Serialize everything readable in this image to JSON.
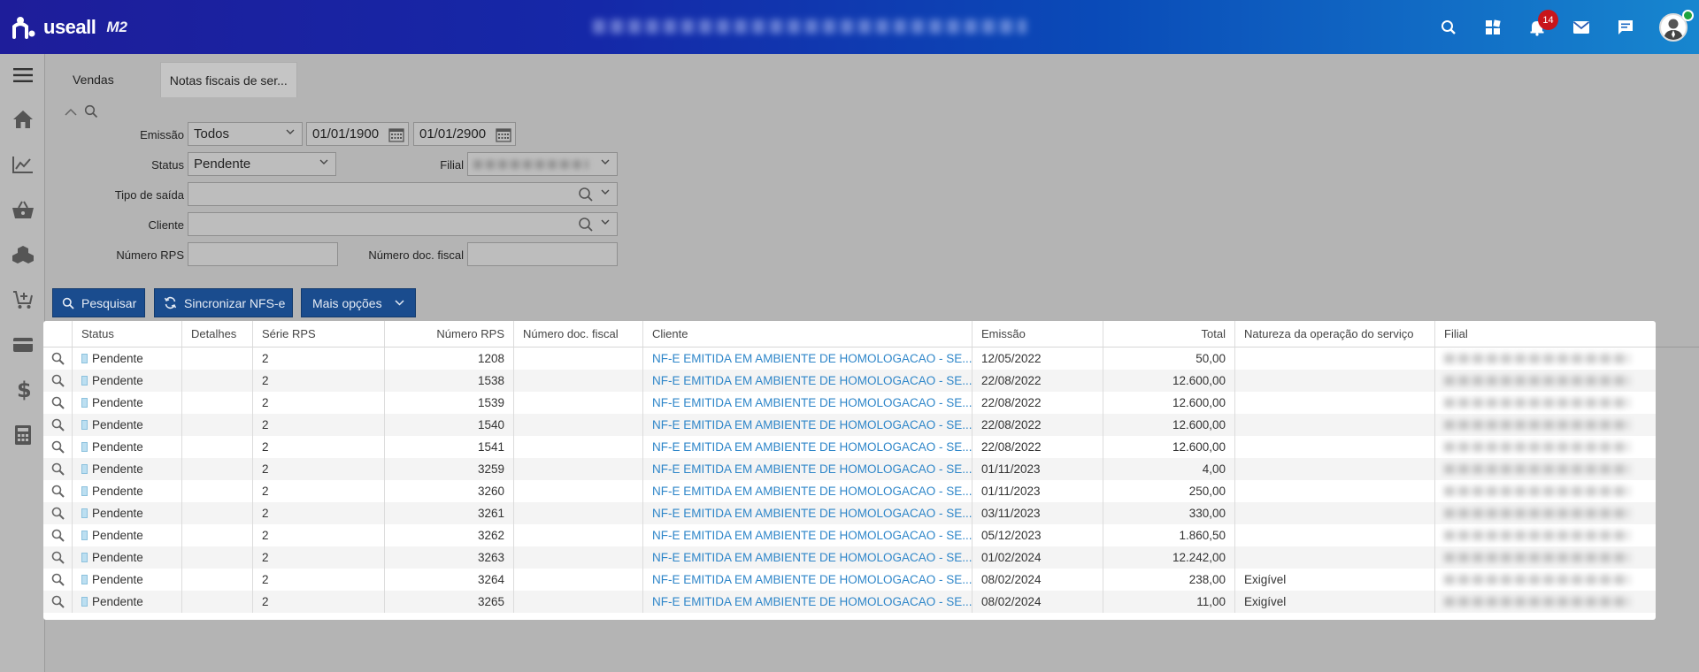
{
  "app": {
    "logo_text": "useall",
    "logo_sub": "M2",
    "notification_count": "14"
  },
  "tabs": [
    {
      "label": "Vendas"
    },
    {
      "label": "Notas fiscais de ser..."
    }
  ],
  "filters": {
    "emissao_label": "Emissão",
    "emissao_value": "Todos",
    "date_from": "01/01/1900",
    "date_to": "01/01/2900",
    "status_label": "Status",
    "status_value": "Pendente",
    "filial_label": "Filial",
    "tipo_saida_label": "Tipo de saída",
    "cliente_label": "Cliente",
    "numero_rps_label": "Número RPS",
    "numero_doc_label": "Número doc. fiscal"
  },
  "buttons": {
    "pesquisar": "Pesquisar",
    "sincronizar": "Sincronizar NFS-e",
    "mais_opcoes": "Mais opções"
  },
  "table": {
    "columns": [
      "",
      "Status",
      "Detalhes",
      "Série RPS",
      "Número RPS",
      "Número doc. fiscal",
      "Cliente",
      "Emissão",
      "Total",
      "Natureza da operação do serviço",
      "Filial"
    ],
    "rows": [
      {
        "status": "Pendente",
        "serie": "2",
        "numero": "1208",
        "cliente": "NF-E EMITIDA EM AMBIENTE DE HOMOLOGACAO - SE...",
        "emissao": "12/05/2022",
        "total": "50,00",
        "natureza": ""
      },
      {
        "status": "Pendente",
        "serie": "2",
        "numero": "1538",
        "cliente": "NF-E EMITIDA EM AMBIENTE DE HOMOLOGACAO - SE...",
        "emissao": "22/08/2022",
        "total": "12.600,00",
        "natureza": ""
      },
      {
        "status": "Pendente",
        "serie": "2",
        "numero": "1539",
        "cliente": "NF-E EMITIDA EM AMBIENTE DE HOMOLOGACAO - SE...",
        "emissao": "22/08/2022",
        "total": "12.600,00",
        "natureza": ""
      },
      {
        "status": "Pendente",
        "serie": "2",
        "numero": "1540",
        "cliente": "NF-E EMITIDA EM AMBIENTE DE HOMOLOGACAO - SE...",
        "emissao": "22/08/2022",
        "total": "12.600,00",
        "natureza": ""
      },
      {
        "status": "Pendente",
        "serie": "2",
        "numero": "1541",
        "cliente": "NF-E EMITIDA EM AMBIENTE DE HOMOLOGACAO - SE...",
        "emissao": "22/08/2022",
        "total": "12.600,00",
        "natureza": ""
      },
      {
        "status": "Pendente",
        "serie": "2",
        "numero": "3259",
        "cliente": "NF-E EMITIDA EM AMBIENTE DE HOMOLOGACAO - SE...",
        "emissao": "01/11/2023",
        "total": "4,00",
        "natureza": ""
      },
      {
        "status": "Pendente",
        "serie": "2",
        "numero": "3260",
        "cliente": "NF-E EMITIDA EM AMBIENTE DE HOMOLOGACAO - SE...",
        "emissao": "01/11/2023",
        "total": "250,00",
        "natureza": ""
      },
      {
        "status": "Pendente",
        "serie": "2",
        "numero": "3261",
        "cliente": "NF-E EMITIDA EM AMBIENTE DE HOMOLOGACAO - SE...",
        "emissao": "03/11/2023",
        "total": "330,00",
        "natureza": ""
      },
      {
        "status": "Pendente",
        "serie": "2",
        "numero": "3262",
        "cliente": "NF-E EMITIDA EM AMBIENTE DE HOMOLOGACAO - SE...",
        "emissao": "05/12/2023",
        "total": "1.860,50",
        "natureza": ""
      },
      {
        "status": "Pendente",
        "serie": "2",
        "numero": "3263",
        "cliente": "NF-E EMITIDA EM AMBIENTE DE HOMOLOGACAO - SE...",
        "emissao": "01/02/2024",
        "total": "12.242,00",
        "natureza": ""
      },
      {
        "status": "Pendente",
        "serie": "2",
        "numero": "3264",
        "cliente": "NF-E EMITIDA EM AMBIENTE DE HOMOLOGACAO - SE...",
        "emissao": "08/02/2024",
        "total": "238,00",
        "natureza": "Exigível"
      },
      {
        "status": "Pendente",
        "serie": "2",
        "numero": "3265",
        "cliente": "NF-E EMITIDA EM AMBIENTE DE HOMOLOGACAO - SE...",
        "emissao": "08/02/2024",
        "total": "11,00",
        "natureza": "Exigível"
      }
    ]
  },
  "colors": {
    "topbar_start": "#1e1d9a",
    "topbar_end": "#1786cf",
    "button_bg": "#1a4c8e",
    "link": "#2e86c9",
    "badge": "#c8151b"
  }
}
